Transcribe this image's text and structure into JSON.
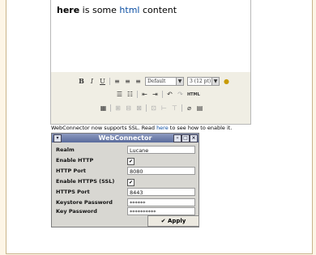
{
  "editor": {
    "word_bold": "here",
    "text_mid": " is some ",
    "word_link": "html",
    "text_end": " content"
  },
  "toolbar": {
    "bold": "B",
    "italic": "I",
    "underline": "U",
    "font_select": "Default",
    "size_select": "3 (12 pt)",
    "html_button": "HTML"
  },
  "notice": {
    "text_before": "WebConnector now supports SSL. Read ",
    "link": "here",
    "text_after": " to see how to enable it."
  },
  "dialog": {
    "title": "WebConnector",
    "fields": [
      {
        "label": "Realm",
        "value": "Lucane"
      },
      {
        "label": "Enable HTTP",
        "checked": true
      },
      {
        "label": "HTTP Port",
        "value": "8080"
      },
      {
        "label": "Enable HTTPS (SSL)",
        "checked": true
      },
      {
        "label": "HTTPS Port",
        "value": "8443"
      },
      {
        "label": "Keystore Password",
        "value": "******"
      },
      {
        "label": "Key Password",
        "value": "**********"
      }
    ],
    "apply_label": "Apply"
  },
  "colors": {
    "accent_link": "#0b4ea2",
    "titlebar": "#5a6b9c",
    "page_bg": "#fdf5e6"
  }
}
